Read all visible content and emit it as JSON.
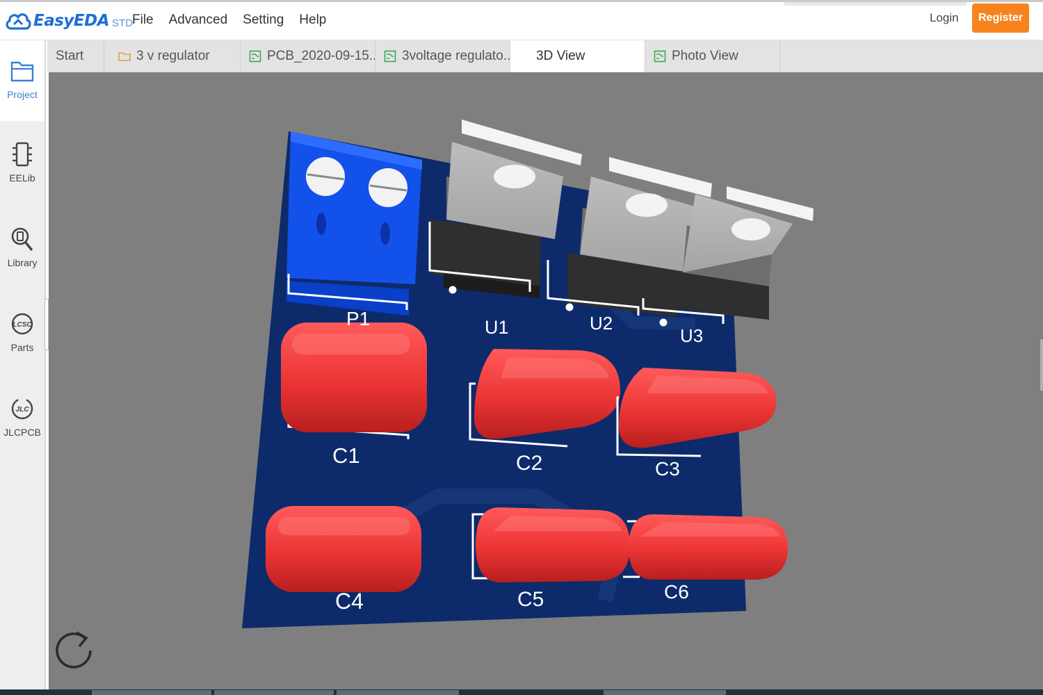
{
  "app": {
    "logo_text": "EasyEDA",
    "logo_suffix": "STD",
    "menu": [
      "File",
      "Advanced",
      "Setting",
      "Help"
    ],
    "login_label": "Login",
    "register_label": "Register",
    "brand_color": "#1f6ed4",
    "accent_color": "#f7831f"
  },
  "sidebar": {
    "items": [
      {
        "label": "Project",
        "icon": "project-icon",
        "active": true
      },
      {
        "label": "EELib",
        "icon": "eelib-icon",
        "active": false
      },
      {
        "label": "Library",
        "icon": "library-icon",
        "active": false
      },
      {
        "label": "Parts",
        "icon": "lcsc-parts-icon",
        "active": false
      },
      {
        "label": "JLCPCB",
        "icon": "jlcpcb-icon",
        "active": false
      }
    ]
  },
  "tabs": [
    {
      "label": "Start",
      "icon": null,
      "active": false
    },
    {
      "label": "3 v regulator",
      "icon": "folder-icon",
      "active": false
    },
    {
      "label": "PCB_2020-09-15...",
      "icon": "pcb-doc-icon",
      "active": false
    },
    {
      "label": "3voltage regulato...",
      "icon": "pcb-doc-icon",
      "active": false
    },
    {
      "label": "3D View",
      "icon": null,
      "active": true
    },
    {
      "label": "Photo View",
      "icon": "pcb-doc-icon",
      "active": false
    }
  ],
  "view3d": {
    "board_color": "#0d2b6b",
    "background_color": "#7f7f7f",
    "silkscreen_color": "#ffffff",
    "component_labels": {
      "p1": "P1",
      "u1": "U1",
      "u2": "U2",
      "u3": "U3",
      "c1": "C1",
      "c2": "C2",
      "c3": "C3",
      "c4": "C4",
      "c5": "C5",
      "c6": "C6"
    },
    "rotate_control_icon": "rotate-icon"
  }
}
